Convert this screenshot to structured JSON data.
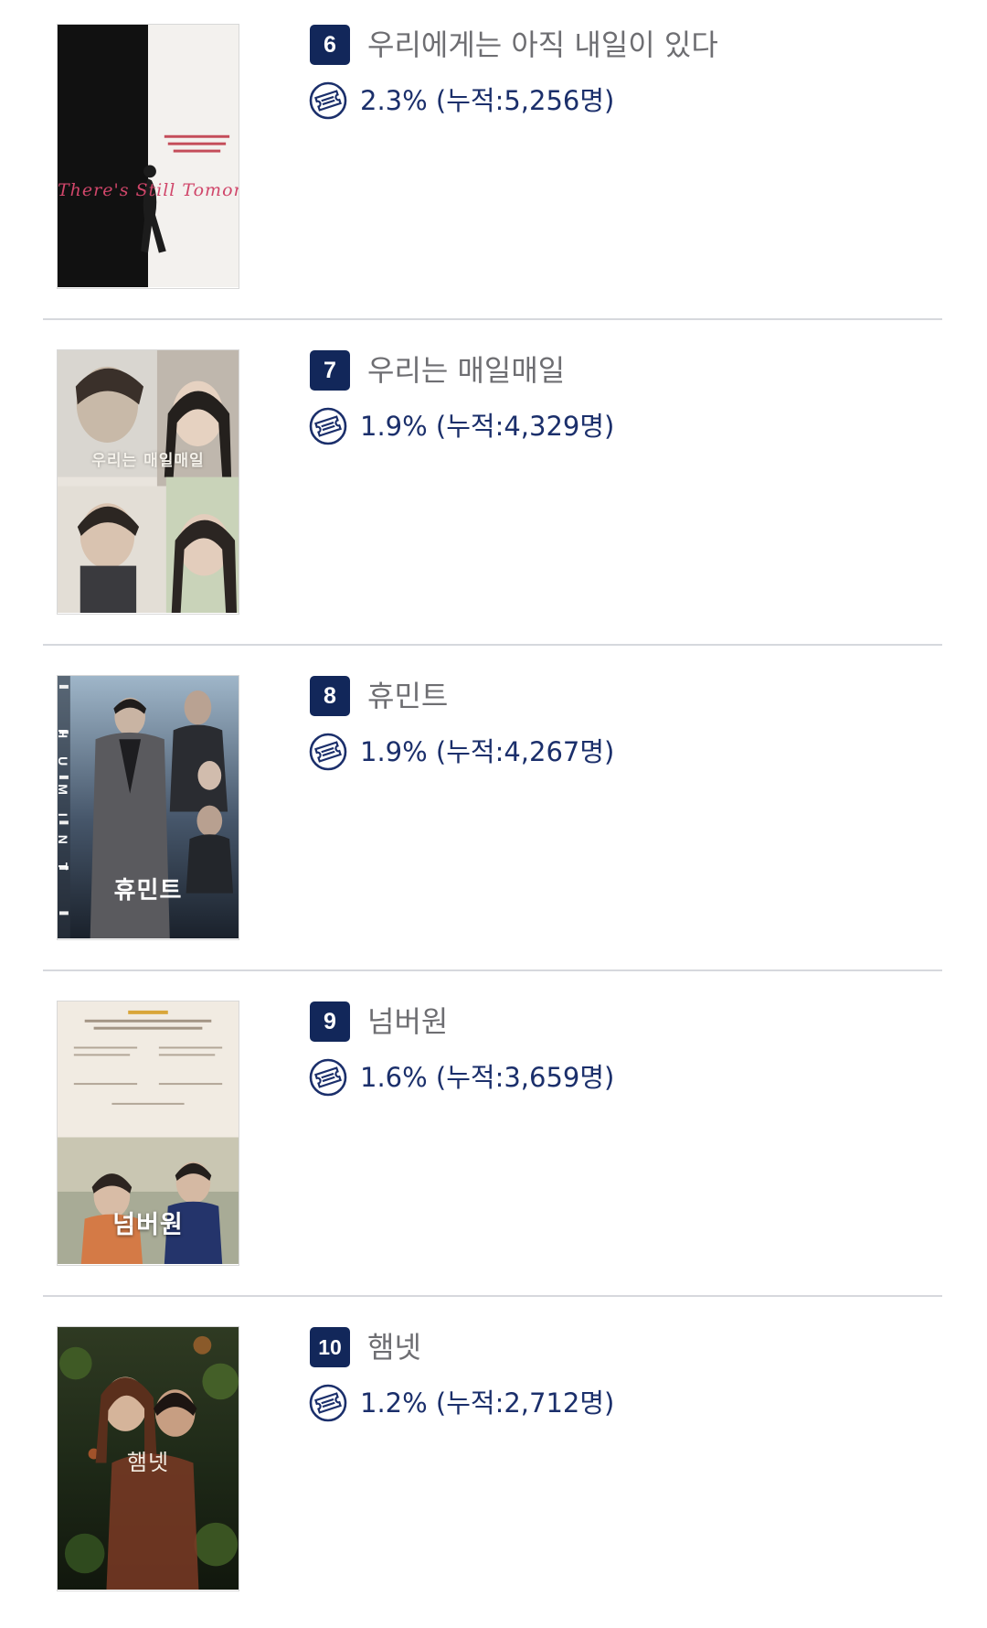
{
  "accent_color": "#12275a",
  "stat_color": "#1b2f6b",
  "title_color": "#6e6e72",
  "movies": [
    {
      "rank": "6",
      "title": "우리에게는 아직 내일이 있다",
      "stat": "2.3% (누적:5,256명)",
      "poster_text": "There's Still Tomorrow",
      "ticket_icon": "ticket-icon"
    },
    {
      "rank": "7",
      "title": "우리는 매일매일",
      "stat": "1.9% (누적:4,329명)",
      "poster_text": "우리는 매일매일",
      "ticket_icon": "ticket-icon"
    },
    {
      "rank": "8",
      "title": "휴민트",
      "stat": "1.9% (누적:4,267명)",
      "poster_text": "휴민트",
      "poster_side_text": "HUMINT",
      "ticket_icon": "ticket-icon"
    },
    {
      "rank": "9",
      "title": "넘버원",
      "stat": "1.6% (누적:3,659명)",
      "poster_text": "넘버원",
      "ticket_icon": "ticket-icon"
    },
    {
      "rank": "10",
      "title": "햄넷",
      "stat": "1.2% (누적:2,712명)",
      "poster_text": "햄넷",
      "ticket_icon": "ticket-icon"
    }
  ]
}
